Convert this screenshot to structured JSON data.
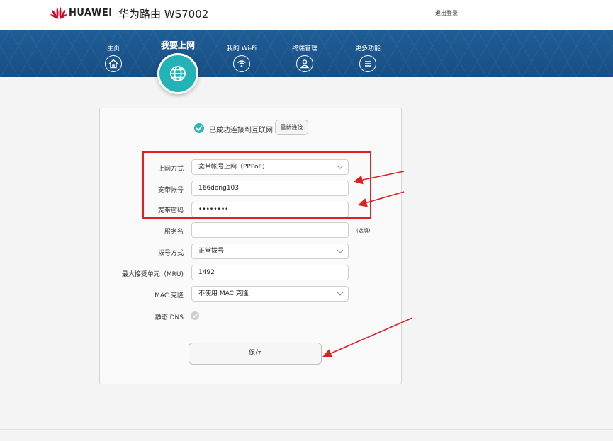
{
  "header": {
    "brand": "HUAWEI",
    "product": "华为路由 WS7002",
    "logout": "退出登录"
  },
  "nav": {
    "items": [
      {
        "label": "主页",
        "icon": "home-icon"
      },
      {
        "label": "我要上网",
        "icon": "globe-icon",
        "active": true
      },
      {
        "label": "我的 Wi-Fi",
        "icon": "wifi-icon"
      },
      {
        "label": "终端管理",
        "icon": "user-icon"
      },
      {
        "label": "更多功能",
        "icon": "menu-icon"
      }
    ]
  },
  "status": {
    "text": "已成功连接到互联网",
    "reconnect_label": "重新连接"
  },
  "form": {
    "mode": {
      "label": "上网方式",
      "value": "宽带帐号上网（PPPoE)"
    },
    "account": {
      "label": "宽带帐号",
      "value": "166dong103"
    },
    "password": {
      "label": "宽带密码",
      "value": "••••••••"
    },
    "service": {
      "label": "服务名",
      "value": "",
      "hint": "(选填)"
    },
    "dial": {
      "label": "拨号方式",
      "value": "正常拨号"
    },
    "mru": {
      "label": "最大接受单元（MRU)",
      "value": "1492"
    },
    "mac": {
      "label": "MAC 克隆",
      "value": "不使用 MAC 克隆"
    },
    "dns": {
      "label": "静态 DNS"
    },
    "save_label": "保存"
  },
  "colors": {
    "nav_bg": "#1f5d95",
    "accent": "#23b3b7",
    "annotation": "#e02020",
    "brand_red": "#cf0a2c"
  }
}
